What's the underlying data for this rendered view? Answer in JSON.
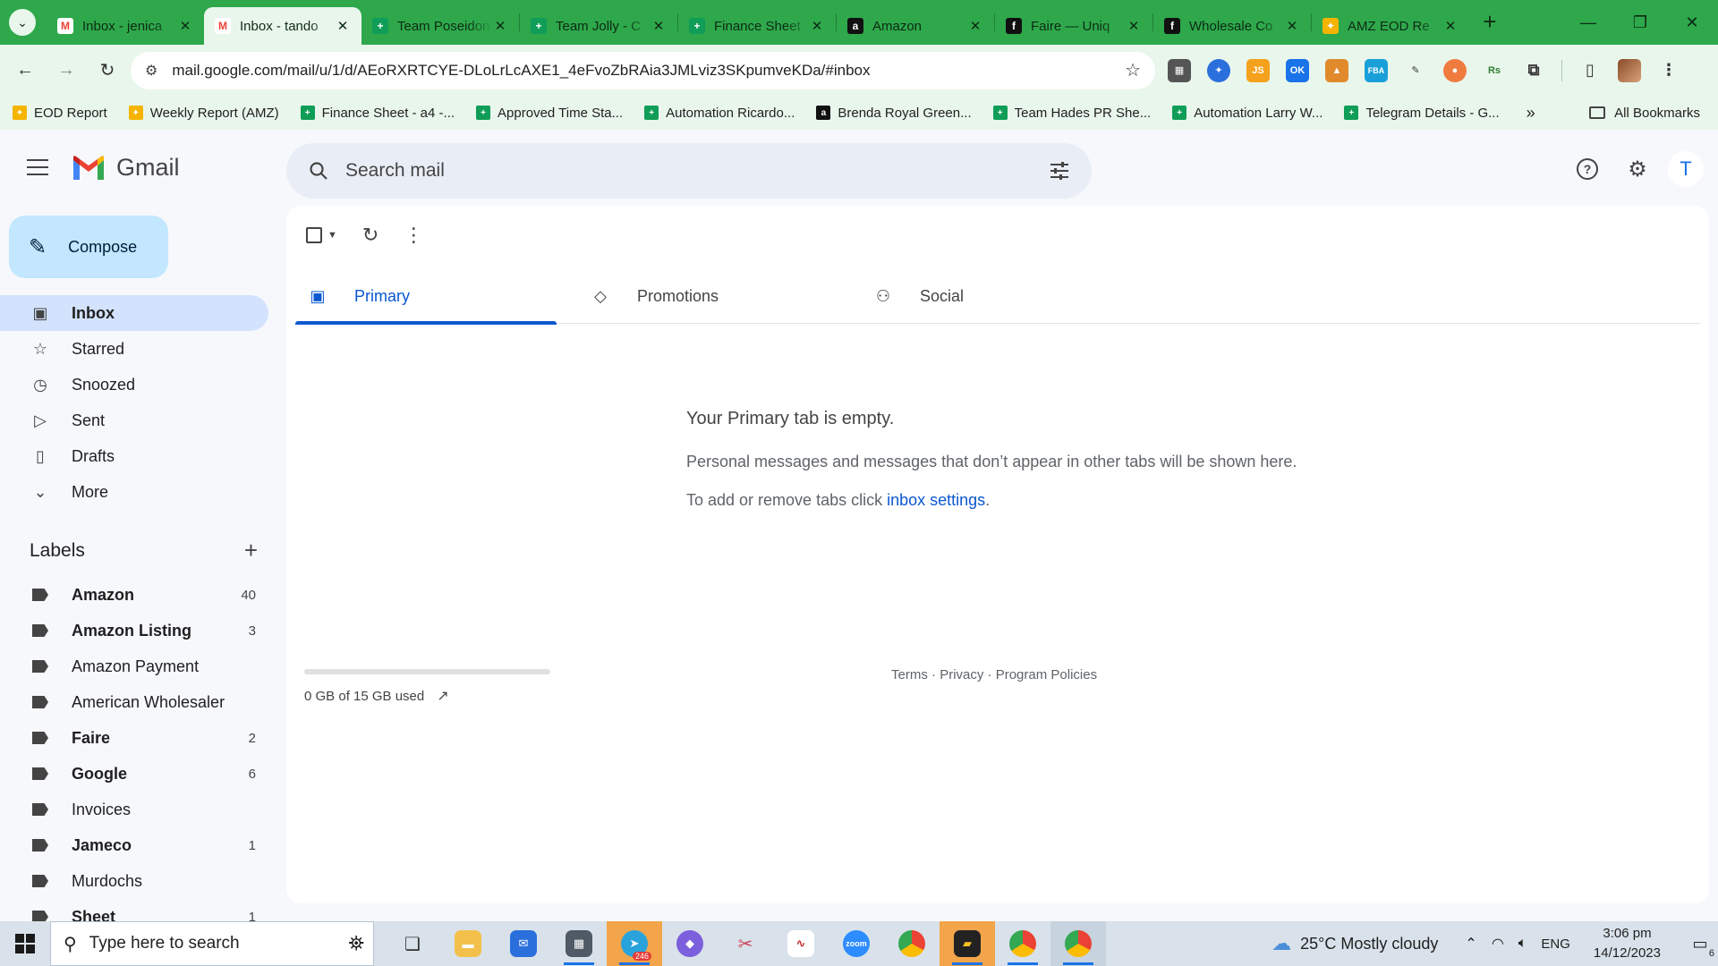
{
  "browser": {
    "tabs": [
      {
        "title": "Inbox - jenica",
        "favicon": "gmail-icon",
        "color": "#ea4335",
        "active": false
      },
      {
        "title": "Inbox - tando",
        "favicon": "gmail-icon",
        "color": "#ea4335",
        "active": true
      },
      {
        "title": "Team Poseidon",
        "favicon": "sheets-icon",
        "color": "#0f9d58",
        "active": false
      },
      {
        "title": "Team Jolly - C",
        "favicon": "sheets-icon",
        "color": "#0f9d58",
        "active": false
      },
      {
        "title": "Finance Sheet",
        "favicon": "sheets-icon",
        "color": "#0f9d58",
        "active": false
      },
      {
        "title": "Amazon",
        "favicon": "amazon-icon",
        "color": "#111111",
        "active": false
      },
      {
        "title": "Faire — Uniq",
        "favicon": "faire-icon",
        "color": "#111111",
        "active": false
      },
      {
        "title": "Wholesale Co",
        "favicon": "faire-icon",
        "color": "#111111",
        "active": false
      },
      {
        "title": "AMZ EOD Re",
        "favicon": "pinwheel-icon",
        "color": "#f4b400",
        "active": false
      }
    ],
    "url": "mail.google.com/mail/u/1/d/AEoRXRTCYE-DLoLrLcAXE1_4eFvoZbRAia3JMLviz3SKpumveKDa/#inbox",
    "bookmarks": [
      {
        "label": "EOD Report",
        "icon": "pinwheel-icon",
        "color": "#f4b400"
      },
      {
        "label": "Weekly Report (AMZ)",
        "icon": "pinwheel-icon",
        "color": "#f4b400"
      },
      {
        "label": "Finance Sheet - a4 -...",
        "icon": "sheets-icon",
        "color": "#0f9d58"
      },
      {
        "label": "Approved Time Sta...",
        "icon": "sheets-icon",
        "color": "#0f9d58"
      },
      {
        "label": "Automation Ricardo...",
        "icon": "sheets-icon",
        "color": "#0f9d58"
      },
      {
        "label": "Brenda Royal Green...",
        "icon": "amazon-icon",
        "color": "#111111"
      },
      {
        "label": "Team Hades PR She...",
        "icon": "sheets-icon",
        "color": "#0f9d58"
      },
      {
        "label": "Automation Larry W...",
        "icon": "sheets-icon",
        "color": "#0f9d58"
      },
      {
        "label": "Telegram Details - G...",
        "icon": "sheets-icon",
        "color": "#0f9d58"
      }
    ],
    "all_bookmarks": "All Bookmarks"
  },
  "gmail": {
    "app_name": "Gmail",
    "search_placeholder": "Search mail",
    "avatar_letter": "T",
    "compose_label": "Compose",
    "nav": [
      {
        "label": "Inbox",
        "icon": "inbox-icon",
        "active": true
      },
      {
        "label": "Starred",
        "icon": "star-icon",
        "active": false
      },
      {
        "label": "Snoozed",
        "icon": "clock-icon",
        "active": false
      },
      {
        "label": "Sent",
        "icon": "send-icon",
        "active": false
      },
      {
        "label": "Drafts",
        "icon": "draft-icon",
        "active": false
      },
      {
        "label": "More",
        "icon": "chevron-down-icon",
        "active": false
      }
    ],
    "labels_title": "Labels",
    "labels": [
      {
        "name": "Amazon",
        "count": "40",
        "bold": true
      },
      {
        "name": "Amazon Listing",
        "count": "3",
        "bold": true
      },
      {
        "name": "Amazon Payment",
        "count": "",
        "bold": false
      },
      {
        "name": "American Wholesaler",
        "count": "",
        "bold": false
      },
      {
        "name": "Faire",
        "count": "2",
        "bold": true
      },
      {
        "name": "Google",
        "count": "6",
        "bold": true
      },
      {
        "name": "Invoices",
        "count": "",
        "bold": false
      },
      {
        "name": "Jameco",
        "count": "1",
        "bold": true
      },
      {
        "name": "Murdochs",
        "count": "",
        "bold": false
      },
      {
        "name": "Sheet",
        "count": "1",
        "bold": true
      }
    ],
    "tabs": [
      {
        "label": "Primary",
        "icon": "inbox-icon",
        "active": true
      },
      {
        "label": "Promotions",
        "icon": "tag-icon",
        "active": false
      },
      {
        "label": "Social",
        "icon": "people-icon",
        "active": false
      }
    ],
    "empty": {
      "title": "Your Primary tab is empty.",
      "line1": "Personal messages and messages that don’t appear in other tabs will be shown here.",
      "line2_prefix": "To add or remove tabs click ",
      "line2_link": "inbox settings",
      "line2_suffix": "."
    },
    "storage": {
      "text": "0 GB of 15 GB used",
      "used_fraction": 0
    },
    "footer": {
      "terms": "Terms",
      "privacy": "Privacy",
      "policies": "Program Policies",
      "sep": " · "
    }
  },
  "taskbar": {
    "search_placeholder": "Type here to search",
    "telegram_badge": "246",
    "weather": "25°C  Mostly cloudy",
    "language": "ENG",
    "time": "3:06 pm",
    "date": "14/12/2023",
    "notification_count": "6"
  }
}
